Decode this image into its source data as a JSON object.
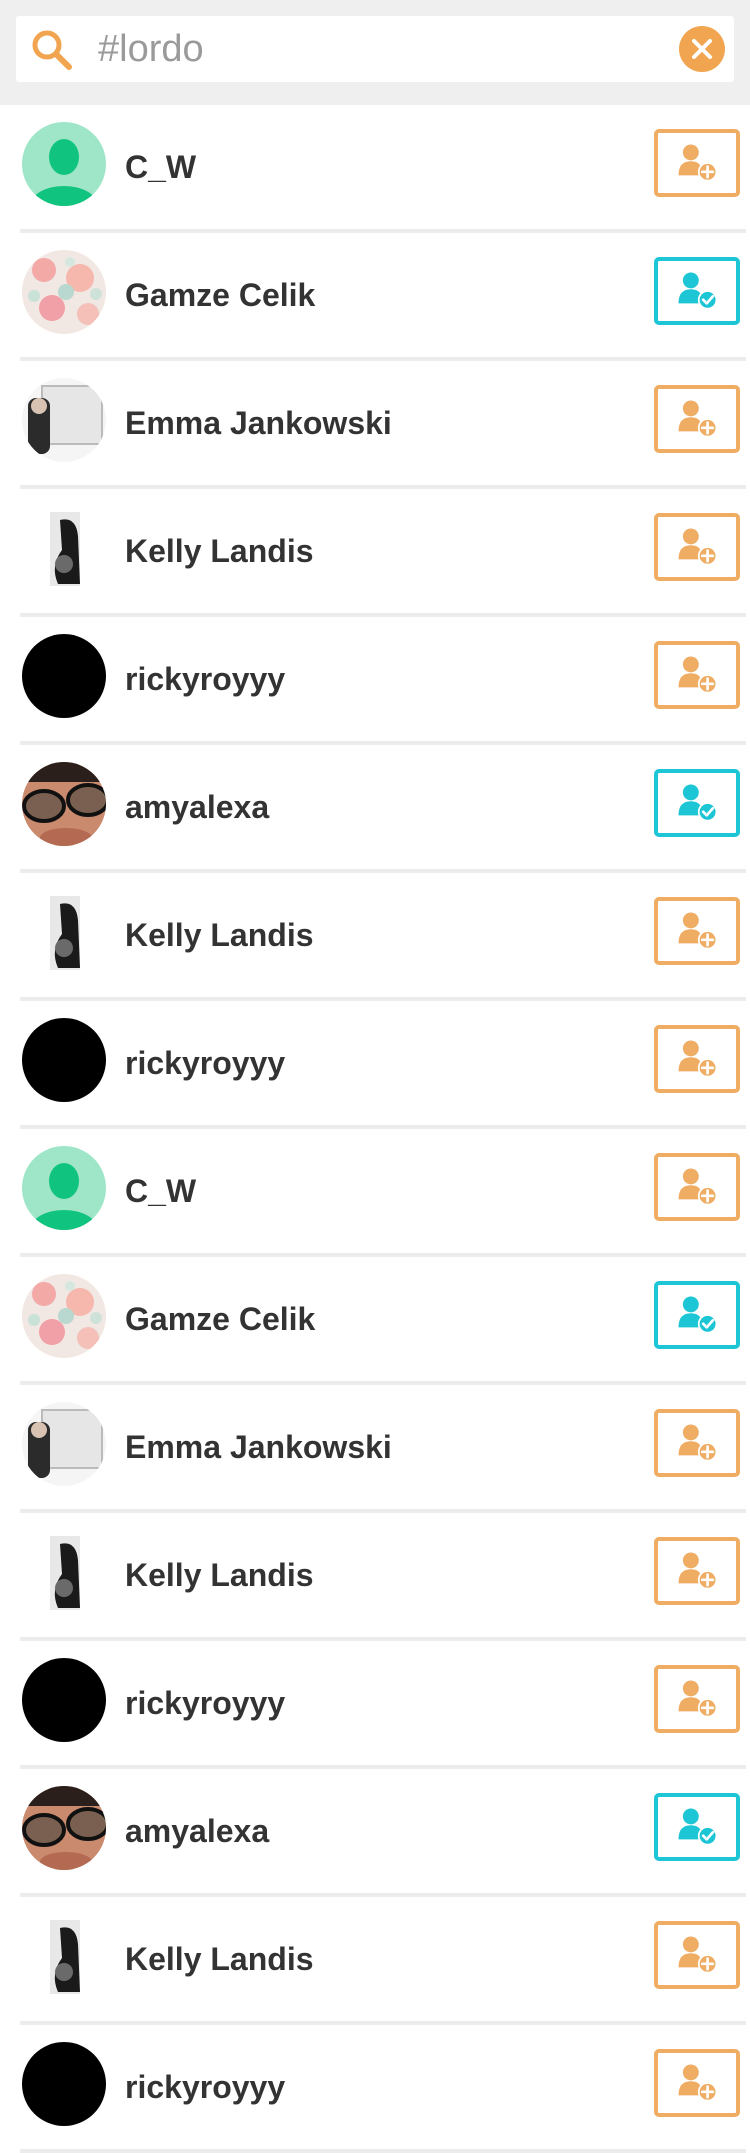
{
  "search": {
    "value": "#lordo",
    "placeholder": "#lordo"
  },
  "colors": {
    "accent_orange": "#efad63",
    "accent_teal": "#1cc6d4",
    "text": "#333333",
    "divider": "#ececec"
  },
  "users": [
    {
      "name": "C_W",
      "following": false,
      "avatar": "default-avatar-icon"
    },
    {
      "name": "Gamze Celik",
      "following": true,
      "avatar": "floral-photo"
    },
    {
      "name": "Emma Jankowski",
      "following": false,
      "avatar": "laptop-photo"
    },
    {
      "name": "Kelly Landis",
      "following": false,
      "avatar": "bw-photo"
    },
    {
      "name": "rickyroyyy",
      "following": false,
      "avatar": "black-photo"
    },
    {
      "name": "amyalexa",
      "following": true,
      "avatar": "sunglasses-photo"
    },
    {
      "name": "Kelly Landis",
      "following": false,
      "avatar": "bw-photo"
    },
    {
      "name": "rickyroyyy",
      "following": false,
      "avatar": "black-photo"
    },
    {
      "name": "C_W",
      "following": false,
      "avatar": "default-avatar-icon"
    },
    {
      "name": "Gamze Celik",
      "following": true,
      "avatar": "floral-photo"
    },
    {
      "name": "Emma Jankowski",
      "following": false,
      "avatar": "laptop-photo"
    },
    {
      "name": "Kelly Landis",
      "following": false,
      "avatar": "bw-photo"
    },
    {
      "name": "rickyroyyy",
      "following": false,
      "avatar": "black-photo"
    },
    {
      "name": "amyalexa",
      "following": true,
      "avatar": "sunglasses-photo"
    },
    {
      "name": "Kelly Landis",
      "following": false,
      "avatar": "bw-photo"
    },
    {
      "name": "rickyroyyy",
      "following": false,
      "avatar": "black-photo"
    }
  ]
}
